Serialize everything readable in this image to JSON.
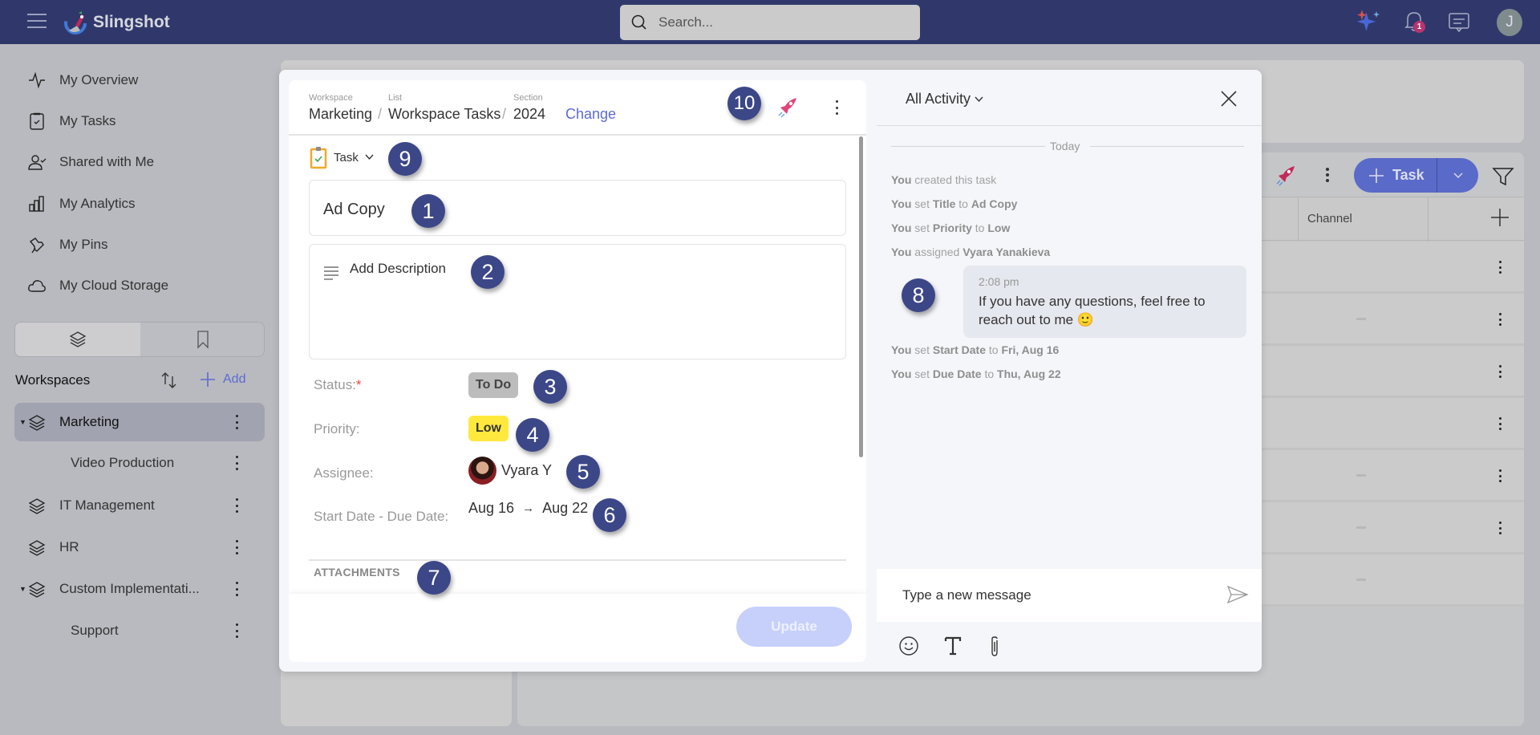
{
  "app": {
    "name": "Slingshot",
    "search_placeholder": "Search...",
    "notification_count": "1",
    "user_initial": "J"
  },
  "sidebar": {
    "nav": [
      {
        "label": "My Overview",
        "icon": "activity-pulse-icon"
      },
      {
        "label": "My Tasks",
        "icon": "clipboard-check-icon"
      },
      {
        "label": "Shared with Me",
        "icon": "user-check-icon"
      },
      {
        "label": "My Analytics",
        "icon": "bar-chart-icon"
      },
      {
        "label": "My Pins",
        "icon": "pin-icon"
      },
      {
        "label": "My Cloud Storage",
        "icon": "cloud-icon"
      }
    ],
    "workspaces_title": "Workspaces",
    "add_label": "Add",
    "workspaces": [
      {
        "label": "Marketing",
        "expanded": true,
        "selected": true,
        "level": 0
      },
      {
        "label": "Video Production",
        "level": 1
      },
      {
        "label": "IT Management",
        "level": 0
      },
      {
        "label": "HR",
        "level": 0
      },
      {
        "label": "Custom Implementati...",
        "expanded": true,
        "level": 0
      },
      {
        "label": "Support",
        "level": 1
      }
    ]
  },
  "background": {
    "add_task_label": "Task",
    "column_channel": "Channel",
    "row_count": 7
  },
  "task": {
    "breadcrumb": {
      "workspace_caption": "Workspace",
      "workspace": "Marketing",
      "list_caption": "List",
      "list": "Workspace Tasks",
      "section_caption": "Section",
      "section": "2024",
      "separator": "/",
      "change_label": "Change"
    },
    "type": "Task",
    "title": "Ad Copy",
    "description_placeholder": "Add Description",
    "fields": {
      "status_label": "Status:",
      "required_mark": "*",
      "status": "To Do",
      "priority_label": "Priority:",
      "priority": "Low",
      "assignee_label": "Assignee:",
      "assignee": "Vyara Y",
      "dates_label": "Start Date - Due Date:",
      "start_date": "Aug 16",
      "arrow": "→",
      "due_date": "Aug 22"
    },
    "attachments_title": "ATTACHMENTS",
    "update_label": "Update"
  },
  "activity": {
    "filter_label": "All Activity",
    "day_label": "Today",
    "entries_before": [
      {
        "actor": "You",
        "verb": "created this task"
      },
      {
        "actor": "You",
        "verb": "set",
        "field": "Title",
        "to": "to",
        "value": "Ad Copy"
      },
      {
        "actor": "You",
        "verb": "set",
        "field": "Priority",
        "to": "to",
        "value": "Low"
      },
      {
        "actor": "You",
        "verb": "assigned",
        "field": "Vyara Yanakieva"
      }
    ],
    "message": {
      "time": "2:08 pm",
      "text": "If you have any questions, feel free to reach out to me 🙂"
    },
    "entries_after": [
      {
        "actor": "You",
        "verb": "set",
        "field": "Start Date",
        "to": "to",
        "value": "Fri, Aug 16"
      },
      {
        "actor": "You",
        "verb": "set",
        "field": "Due Date",
        "to": "to",
        "value": "Thu, Aug 22"
      }
    ],
    "composer_placeholder": "Type a new message"
  },
  "markers": [
    "1",
    "2",
    "3",
    "4",
    "5",
    "6",
    "7",
    "8",
    "9",
    "10"
  ],
  "colors": {
    "topbar": "#30386b",
    "accent": "#5d6bd1",
    "priority_low": "#ffe93d",
    "status_todo": "#bcbcbc",
    "marker": "#3c4788",
    "rocket": "#e0457b"
  }
}
